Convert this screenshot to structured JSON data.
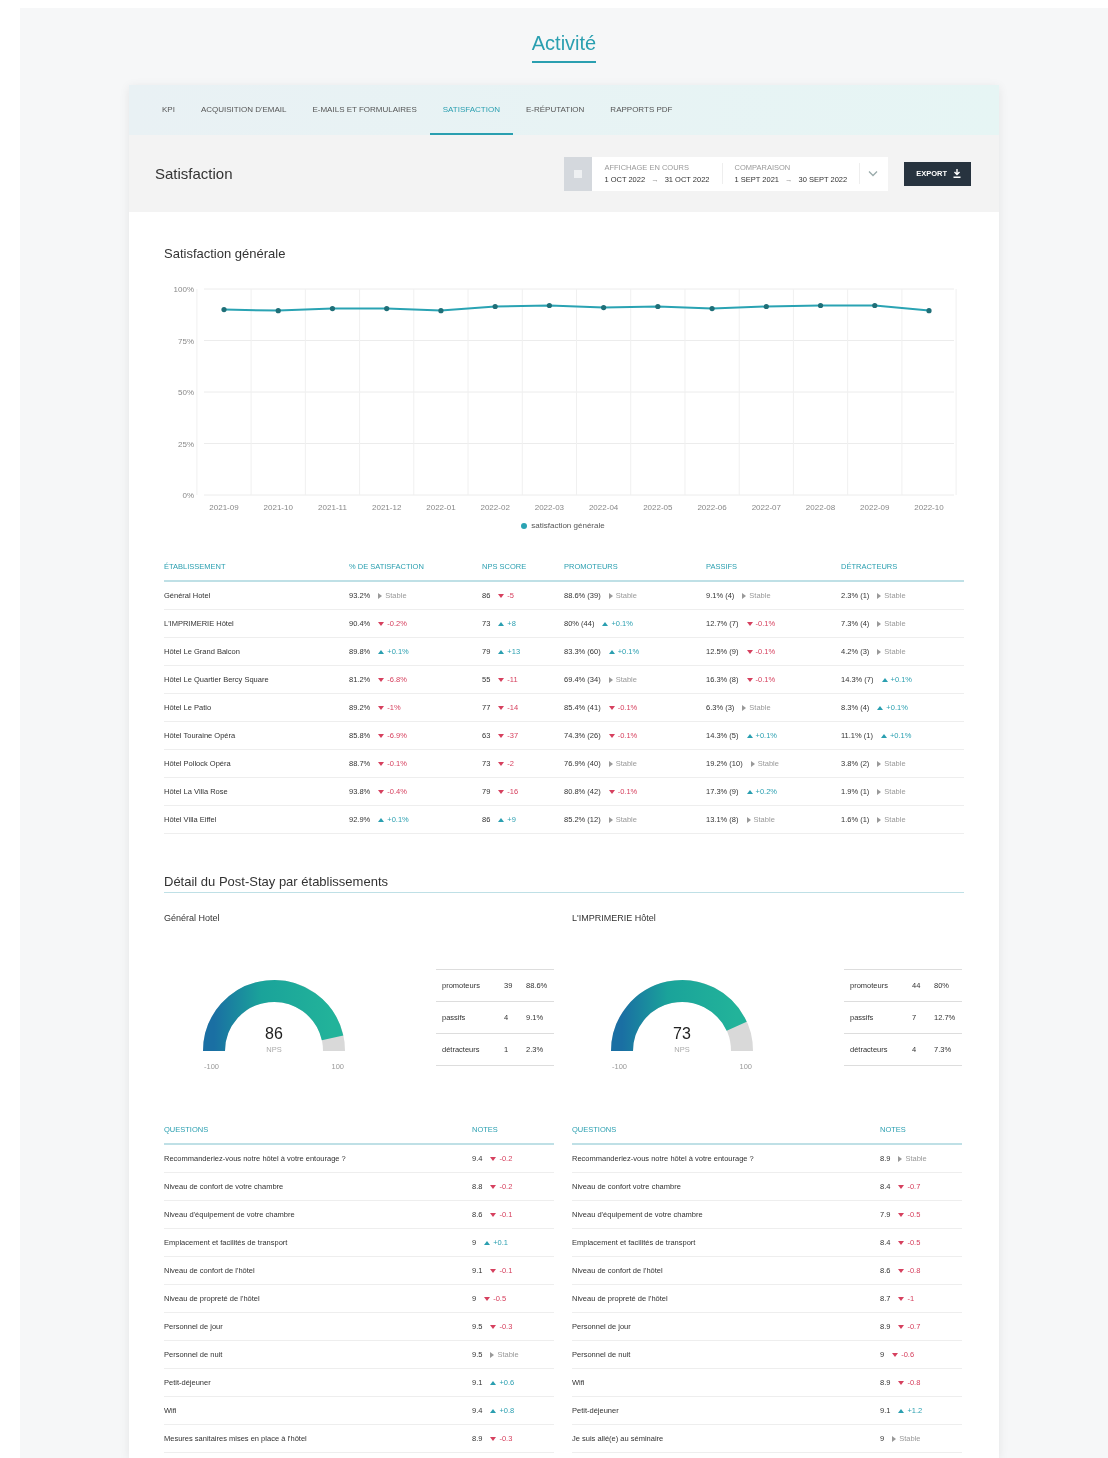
{
  "page_title": "Activité",
  "tabs": [
    {
      "label": "KPI",
      "selected": false
    },
    {
      "label": "ACQUISITION D'EMAIL",
      "selected": false
    },
    {
      "label": "E-MAILS ET FORMULAIRES",
      "selected": false
    },
    {
      "label": "SATISFACTION",
      "selected": true
    },
    {
      "label": "E-RÉPUTATION",
      "selected": false
    },
    {
      "label": "RAPPORTS PDF",
      "selected": false
    }
  ],
  "header": {
    "title": "Satisfaction",
    "periods": [
      {
        "label": "AFFICHAGE EN COURS",
        "start": "1 OCT 2022",
        "arrow": "→",
        "end": "31 OCT 2022"
      },
      {
        "label": "COMPARAISON",
        "start": "1 SEPT 2021",
        "arrow": "→",
        "end": "30 SEPT 2022"
      }
    ],
    "export_button": "EXPORT"
  },
  "overview": {
    "title": "Satisfaction générale",
    "chart_data": {
      "type": "line",
      "categories": [
        "2021-09",
        "2021-10",
        "2021-11",
        "2021-12",
        "2022-01",
        "2022-02",
        "2022-03",
        "2022-04",
        "2022-05",
        "2022-06",
        "2022-07",
        "2022-08",
        "2022-09",
        "2022-10"
      ],
      "series": [
        {
          "name": "satisfaction générale",
          "color": "#2aa3b3",
          "values": [
            90,
            89.5,
            90.5,
            90.5,
            89.5,
            91.5,
            92,
            91,
            91.5,
            90.5,
            91.5,
            92,
            92,
            89.5
          ]
        }
      ],
      "grid": true,
      "ylim": [
        0,
        100
      ],
      "yticks": [
        {
          "value": 0,
          "label": "0%"
        },
        {
          "value": 25,
          "label": "25%"
        },
        {
          "value": 50,
          "label": "50%"
        },
        {
          "value": 75,
          "label": "75%"
        },
        {
          "value": 100,
          "label": "100%"
        }
      ]
    }
  },
  "table": {
    "columns": [
      "ÉTABLISSEMENT",
      "% DE SATISFACTION",
      "NPS SCORE",
      "PROMOTEURS",
      "PASSIFS",
      "DÉTRACTEURS"
    ],
    "rows": [
      {
        "cells": [
          {
            "value": "Général Hotel"
          },
          {
            "value": "93.2%",
            "trend": {
              "kind": "stable",
              "text": "Stable"
            }
          },
          {
            "value": "86",
            "trend": {
              "kind": "down",
              "text": "-5"
            }
          },
          {
            "value": "88.6% (39)",
            "trend": {
              "kind": "stable",
              "text": "Stable"
            }
          },
          {
            "value": "9.1% (4)",
            "trend": {
              "kind": "stable",
              "text": "Stable"
            }
          },
          {
            "value": "2.3% (1)",
            "trend": {
              "kind": "stable",
              "text": "Stable"
            }
          }
        ]
      },
      {
        "cells": [
          {
            "value": "L'IMPRIMERIE Hôtel"
          },
          {
            "value": "90.4%",
            "trend": {
              "kind": "down",
              "text": "-0.2%"
            }
          },
          {
            "value": "73",
            "trend": {
              "kind": "up",
              "text": "+8"
            }
          },
          {
            "value": "80% (44)",
            "trend": {
              "kind": "up",
              "text": "+0.1%"
            }
          },
          {
            "value": "12.7% (7)",
            "trend": {
              "kind": "down",
              "text": "-0.1%"
            }
          },
          {
            "value": "7.3% (4)",
            "trend": {
              "kind": "stable",
              "text": "Stable"
            }
          }
        ]
      },
      {
        "cells": [
          {
            "value": "Hôtel Le Grand Balcon"
          },
          {
            "value": "89.8%",
            "trend": {
              "kind": "up",
              "text": "+0.1%"
            }
          },
          {
            "value": "79",
            "trend": {
              "kind": "up",
              "text": "+13"
            }
          },
          {
            "value": "83.3% (60)",
            "trend": {
              "kind": "up",
              "text": "+0.1%"
            }
          },
          {
            "value": "12.5% (9)",
            "trend": {
              "kind": "down",
              "text": "-0.1%"
            }
          },
          {
            "value": "4.2% (3)",
            "trend": {
              "kind": "stable",
              "text": "Stable"
            }
          }
        ]
      },
      {
        "cells": [
          {
            "value": "Hôtel Le Quartier Bercy Square"
          },
          {
            "value": "81.2%",
            "trend": {
              "kind": "down",
              "text": "-6.8%"
            }
          },
          {
            "value": "55",
            "trend": {
              "kind": "down",
              "text": "-11"
            }
          },
          {
            "value": "69.4% (34)",
            "trend": {
              "kind": "stable",
              "text": "Stable"
            }
          },
          {
            "value": "16.3% (8)",
            "trend": {
              "kind": "down",
              "text": "-0.1%"
            }
          },
          {
            "value": "14.3% (7)",
            "trend": {
              "kind": "up",
              "text": "+0.1%"
            }
          }
        ]
      },
      {
        "cells": [
          {
            "value": "Hôtel Le Patio"
          },
          {
            "value": "89.2%",
            "trend": {
              "kind": "down",
              "text": "-1%"
            }
          },
          {
            "value": "77",
            "trend": {
              "kind": "down",
              "text": "-14"
            }
          },
          {
            "value": "85.4% (41)",
            "trend": {
              "kind": "down",
              "text": "-0.1%"
            }
          },
          {
            "value": "6.3% (3)",
            "trend": {
              "kind": "stable",
              "text": "Stable"
            }
          },
          {
            "value": "8.3% (4)",
            "trend": {
              "kind": "up",
              "text": "+0.1%"
            }
          }
        ]
      },
      {
        "cells": [
          {
            "value": "Hôtel Touraine Opéra"
          },
          {
            "value": "85.8%",
            "trend": {
              "kind": "down",
              "text": "-6.9%"
            }
          },
          {
            "value": "63",
            "trend": {
              "kind": "down",
              "text": "-37"
            }
          },
          {
            "value": "74.3% (26)",
            "trend": {
              "kind": "down",
              "text": "-0.1%"
            }
          },
          {
            "value": "14.3% (5)",
            "trend": {
              "kind": "up",
              "text": "+0.1%"
            }
          },
          {
            "value": "11.1% (1)",
            "trend": {
              "kind": "up",
              "text": "+0.1%"
            }
          }
        ]
      },
      {
        "cells": [
          {
            "value": "Hôtel Pollock Opéra"
          },
          {
            "value": "88.7%",
            "trend": {
              "kind": "down",
              "text": "-0.1%"
            }
          },
          {
            "value": "73",
            "trend": {
              "kind": "down",
              "text": "-2"
            }
          },
          {
            "value": "76.9% (40)",
            "trend": {
              "kind": "stable",
              "text": "Stable"
            }
          },
          {
            "value": "19.2% (10)",
            "trend": {
              "kind": "stable",
              "text": "Stable"
            }
          },
          {
            "value": "3.8% (2)",
            "trend": {
              "kind": "stable",
              "text": "Stable"
            }
          }
        ]
      },
      {
        "cells": [
          {
            "value": "Hôtel La Villa Rose"
          },
          {
            "value": "93.8%",
            "trend": {
              "kind": "down",
              "text": "-0.4%"
            }
          },
          {
            "value": "79",
            "trend": {
              "kind": "down",
              "text": "-16"
            }
          },
          {
            "value": "80.8% (42)",
            "trend": {
              "kind": "down",
              "text": "-0.1%"
            }
          },
          {
            "value": "17.3% (9)",
            "trend": {
              "kind": "up",
              "text": "+0.2%"
            }
          },
          {
            "value": "1.9% (1)",
            "trend": {
              "kind": "stable",
              "text": "Stable"
            }
          }
        ]
      },
      {
        "cells": [
          {
            "value": "Hôtel Villa Eiffel"
          },
          {
            "value": "92.9%",
            "trend": {
              "kind": "up",
              "text": "+0.1%"
            }
          },
          {
            "value": "86",
            "trend": {
              "kind": "up",
              "text": "+9"
            }
          },
          {
            "value": "85.2% (12)",
            "trend": {
              "kind": "stable",
              "text": "Stable"
            }
          },
          {
            "value": "13.1% (8)",
            "trend": {
              "kind": "stable",
              "text": "Stable"
            }
          },
          {
            "value": "1.6% (1)",
            "trend": {
              "kind": "stable",
              "text": "Stable"
            }
          }
        ]
      }
    ]
  },
  "post_stay": {
    "title": "Détail du Post-Stay par établissements",
    "hotels": [
      {
        "name": "Général Hotel",
        "gauge": {
          "value": "86",
          "unit": "NPS",
          "min": "-100",
          "max": "100"
        },
        "breakdown": [
          {
            "label": "promoteurs",
            "count": "39",
            "share": "88.6%"
          },
          {
            "label": "passifs",
            "count": "4",
            "share": "9.1%"
          },
          {
            "label": "détracteurs",
            "count": "1",
            "share": "2.3%"
          }
        ],
        "questions": {
          "columns": [
            "QUESTIONS",
            "NOTES"
          ],
          "rows": [
            {
              "question": "Recommanderiez-vous notre hôtel à votre entourage ?",
              "note": "9.4",
              "trend": {
                "kind": "down",
                "text": "-0.2"
              }
            },
            {
              "question": "Niveau de confort de votre chambre",
              "note": "8.8",
              "trend": {
                "kind": "down",
                "text": "-0.2"
              }
            },
            {
              "question": "Niveau d'équipement de votre chambre",
              "note": "8.6",
              "trend": {
                "kind": "down",
                "text": "-0.1"
              }
            },
            {
              "question": "Emplacement et facilités de transport",
              "note": "9",
              "trend": {
                "kind": "up",
                "text": "+0.1"
              }
            },
            {
              "question": "Niveau de confort de l'hôtel",
              "note": "9.1",
              "trend": {
                "kind": "down",
                "text": "-0.1"
              }
            },
            {
              "question": "Niveau de propreté de l'hôtel",
              "note": "9",
              "trend": {
                "kind": "down",
                "text": "-0.5"
              }
            },
            {
              "question": "Personnel de jour",
              "note": "9.5",
              "trend": {
                "kind": "down",
                "text": "-0.3"
              }
            },
            {
              "question": "Personnel de nuit",
              "note": "9.5",
              "trend": {
                "kind": "stable",
                "text": "Stable"
              }
            },
            {
              "question": "Petit-déjeuner",
              "note": "9.1",
              "trend": {
                "kind": "up",
                "text": "+0.6"
              }
            },
            {
              "question": "Wifi",
              "note": "9.4",
              "trend": {
                "kind": "up",
                "text": "+0.8"
              }
            },
            {
              "question": "Mesures sanitaires mises en place à l'hôtel",
              "note": "8.9",
              "trend": {
                "kind": "down",
                "text": "-0.3"
              }
            }
          ]
        }
      },
      {
        "name": "L'IMPRIMERIE Hôtel",
        "gauge": {
          "value": "73",
          "unit": "NPS",
          "min": "-100",
          "max": "100"
        },
        "breakdown": [
          {
            "label": "promoteurs",
            "count": "44",
            "share": "80%"
          },
          {
            "label": "passifs",
            "count": "7",
            "share": "12.7%"
          },
          {
            "label": "détracteurs",
            "count": "4",
            "share": "7.3%"
          }
        ],
        "questions": {
          "columns": [
            "QUESTIONS",
            "NOTES"
          ],
          "rows": [
            {
              "question": "Recommanderiez-vous notre hôtel à votre entourage ?",
              "note": "8.9",
              "trend": {
                "kind": "stable",
                "text": "Stable"
              }
            },
            {
              "question": "Niveau de confort votre chambre",
              "note": "8.4",
              "trend": {
                "kind": "down",
                "text": "-0.7"
              }
            },
            {
              "question": "Niveau d'équipement de votre chambre",
              "note": "7.9",
              "trend": {
                "kind": "down",
                "text": "-0.5"
              }
            },
            {
              "question": "Emplacement et facilités de transport",
              "note": "8.4",
              "trend": {
                "kind": "down",
                "text": "-0.5"
              }
            },
            {
              "question": "Niveau de confort de l'hôtel",
              "note": "8.6",
              "trend": {
                "kind": "down",
                "text": "-0.8"
              }
            },
            {
              "question": "Niveau de propreté de l'hôtel",
              "note": "8.7",
              "trend": {
                "kind": "down",
                "text": "-1"
              }
            },
            {
              "question": "Personnel de jour",
              "note": "8.9",
              "trend": {
                "kind": "down",
                "text": "-0.7"
              }
            },
            {
              "question": "Personnel de nuit",
              "note": "9",
              "trend": {
                "kind": "down",
                "text": "-0.6"
              }
            },
            {
              "question": "Wifi",
              "note": "8.9",
              "trend": {
                "kind": "down",
                "text": "-0.8"
              }
            },
            {
              "question": "Petit-déjeuner",
              "note": "9.1",
              "trend": {
                "kind": "up",
                "text": "+1.2"
              }
            },
            {
              "question": "Je suis allé(e) au séminaire",
              "note": "9",
              "trend": {
                "kind": "stable",
                "text": "Stable"
              }
            }
          ]
        }
      }
    ]
  }
}
